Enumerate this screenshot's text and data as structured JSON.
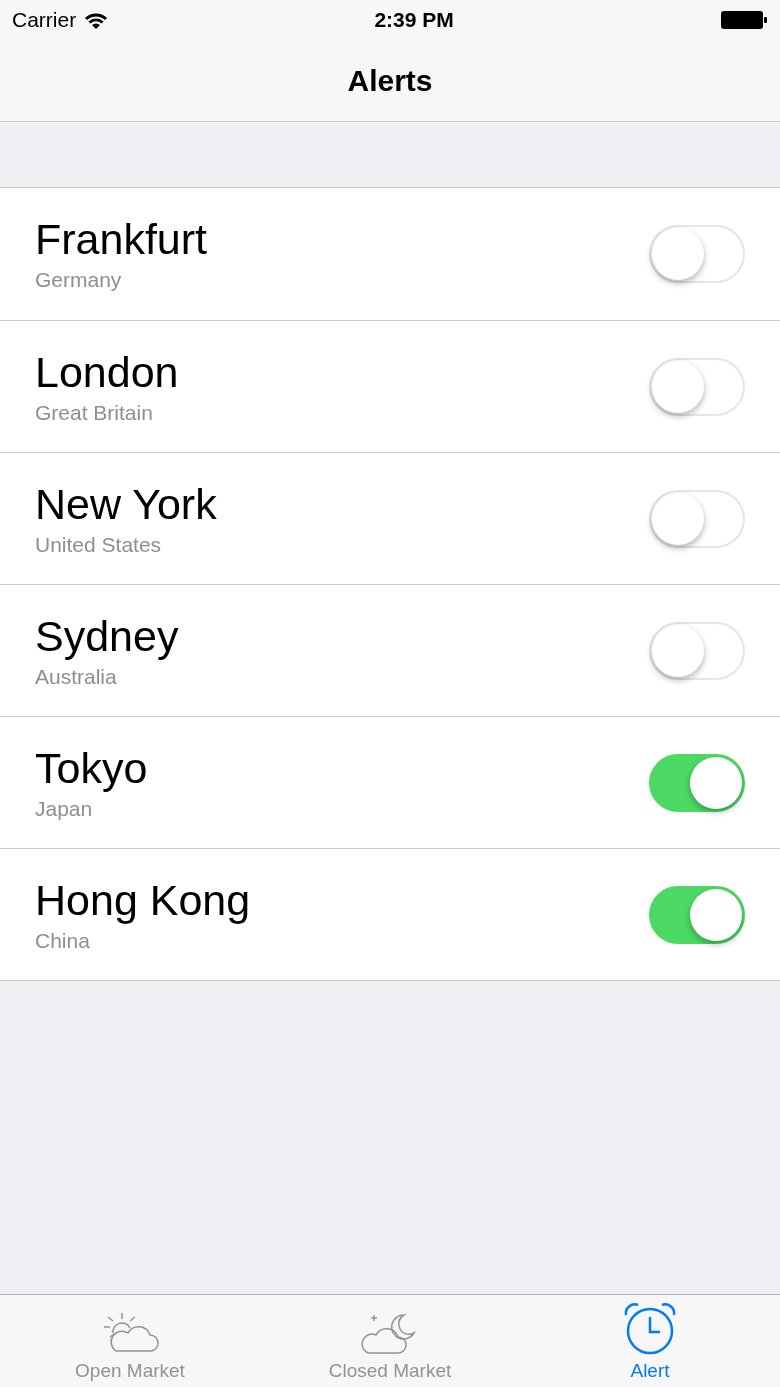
{
  "status_bar": {
    "carrier": "Carrier",
    "time": "2:39 PM"
  },
  "navigation_bar": {
    "title": "Alerts"
  },
  "alerts": [
    {
      "city": "Frankfurt",
      "country": "Germany",
      "on": false
    },
    {
      "city": "London",
      "country": "Great Britain",
      "on": false
    },
    {
      "city": "New York",
      "country": "United States",
      "on": false
    },
    {
      "city": "Sydney",
      "country": "Australia",
      "on": false
    },
    {
      "city": "Tokyo",
      "country": "Japan",
      "on": true
    },
    {
      "city": "Hong Kong",
      "country": "China",
      "on": true
    }
  ],
  "tab_bar": [
    {
      "label": "Open Market",
      "kind": "sun",
      "selected": false
    },
    {
      "label": "Closed Market",
      "kind": "moon",
      "selected": false
    },
    {
      "label": "Alert",
      "kind": "alarm",
      "selected": true
    }
  ]
}
